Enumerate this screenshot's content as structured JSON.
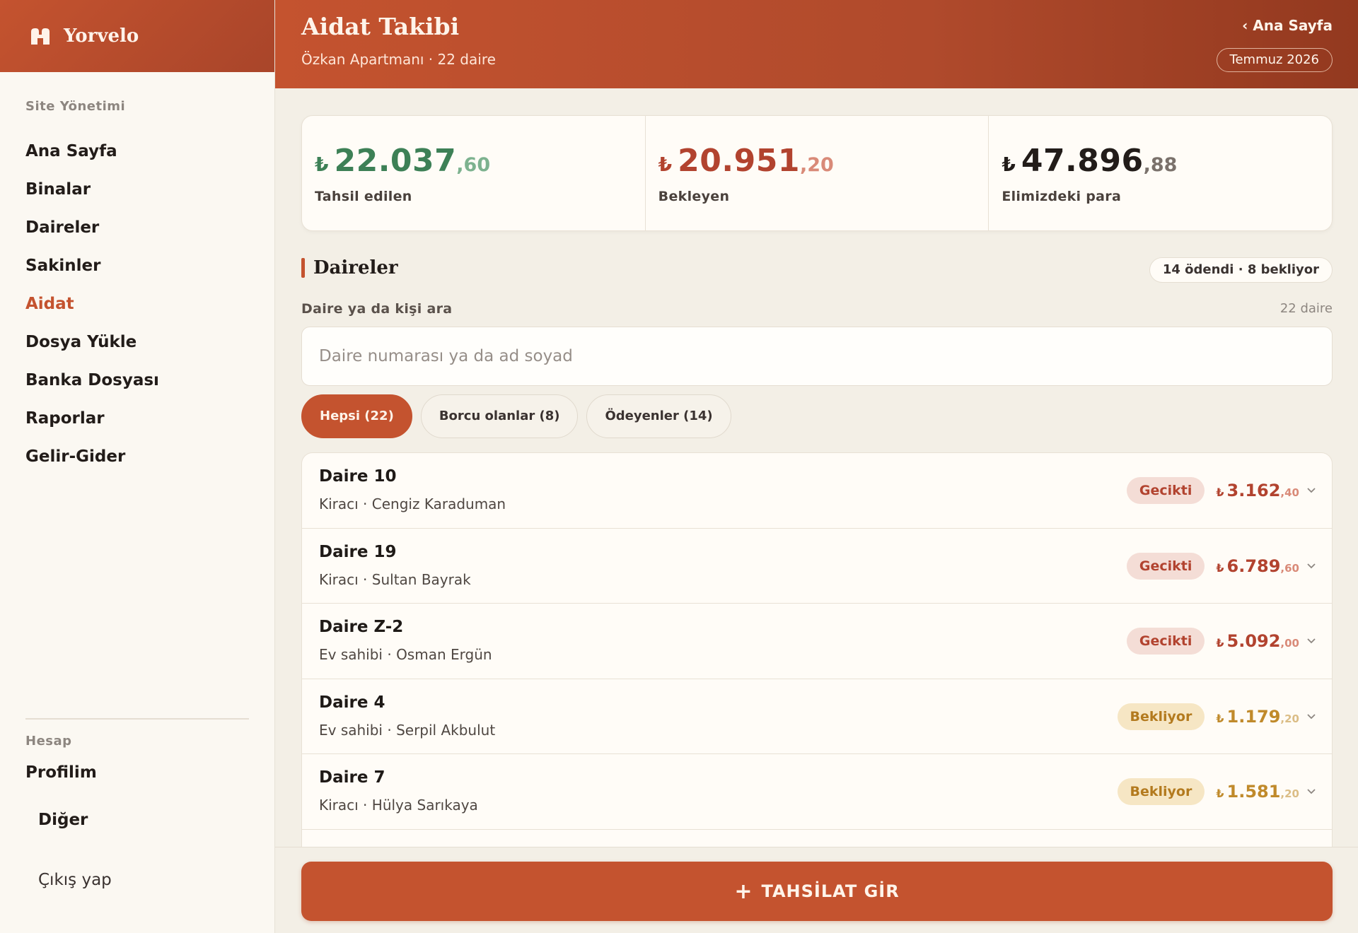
{
  "brand": {
    "name": "Yorvelo",
    "icon": "building-logo-icon"
  },
  "sidebar": {
    "section_label": "Site Yönetimi",
    "items": [
      {
        "label": "Ana Sayfa",
        "active": false
      },
      {
        "label": "Binalar",
        "active": false
      },
      {
        "label": "Daireler",
        "active": false
      },
      {
        "label": "Sakinler",
        "active": false
      },
      {
        "label": "Aidat",
        "active": true
      },
      {
        "label": "Dosya Yükle",
        "active": false
      },
      {
        "label": "Banka Dosyası",
        "active": false
      },
      {
        "label": "Raporlar",
        "active": false
      },
      {
        "label": "Gelir-Gider",
        "active": false
      }
    ],
    "account_label": "Hesap",
    "profile": "Profilim",
    "other": "Diğer",
    "logout": "Çıkış yap"
  },
  "header": {
    "title": "Aidat Takibi",
    "subtitle": "Özkan Apartmanı · 22 daire",
    "back": "‹ Ana Sayfa",
    "period": "Temmuz 2026"
  },
  "stats": [
    {
      "currency": "₺",
      "int": "22.037",
      "dec": ",60",
      "label": "Tahsil edilen",
      "tone": "green"
    },
    {
      "currency": "₺",
      "int": "20.951",
      "dec": ",20",
      "label": "Bekleyen",
      "tone": "red"
    },
    {
      "currency": "₺",
      "int": "47.896",
      "dec": ",88",
      "label": "Elimizdeki para",
      "tone": "dark"
    }
  ],
  "section": {
    "title": "Daireler",
    "count_pill": "14 ödendi · 8 bekliyor",
    "search_label": "Daire ya da kişi ara",
    "search_count": "22 daire",
    "search_placeholder": "Daire numarası ya da ad soyad",
    "search_value": ""
  },
  "filters": [
    {
      "label": "Hepsi (22)",
      "active": true
    },
    {
      "label": "Borcu olanlar (8)",
      "active": false
    },
    {
      "label": "Ödeyenler (14)",
      "active": false
    }
  ],
  "rows": [
    {
      "title": "Daire 10",
      "sub": "Kiracı · Cengiz Karaduman",
      "status": "Gecikti",
      "tone": "late",
      "currency": "₺",
      "int": "3.162",
      "dec": ",40"
    },
    {
      "title": "Daire 19",
      "sub": "Kiracı · Sultan Bayrak",
      "status": "Gecikti",
      "tone": "late",
      "currency": "₺",
      "int": "6.789",
      "dec": ",60"
    },
    {
      "title": "Daire Z-2",
      "sub": "Ev sahibi · Osman Ergün",
      "status": "Gecikti",
      "tone": "late",
      "currency": "₺",
      "int": "5.092",
      "dec": ",00"
    },
    {
      "title": "Daire 4",
      "sub": "Ev sahibi · Serpil Akbulut",
      "status": "Bekliyor",
      "tone": "pending",
      "currency": "₺",
      "int": "1.179",
      "dec": ",20"
    },
    {
      "title": "Daire 7",
      "sub": "Kiracı · Hülya Sarıkaya",
      "status": "Bekliyor",
      "tone": "pending",
      "currency": "₺",
      "int": "1.581",
      "dec": ",20"
    }
  ],
  "cta": {
    "plus": "+",
    "label": "TAHSİLAT GİR"
  },
  "colors": {
    "accent": "#c4532f",
    "paid": "#3d8056",
    "late": "#b2432f",
    "pending": "#c08a2b"
  }
}
